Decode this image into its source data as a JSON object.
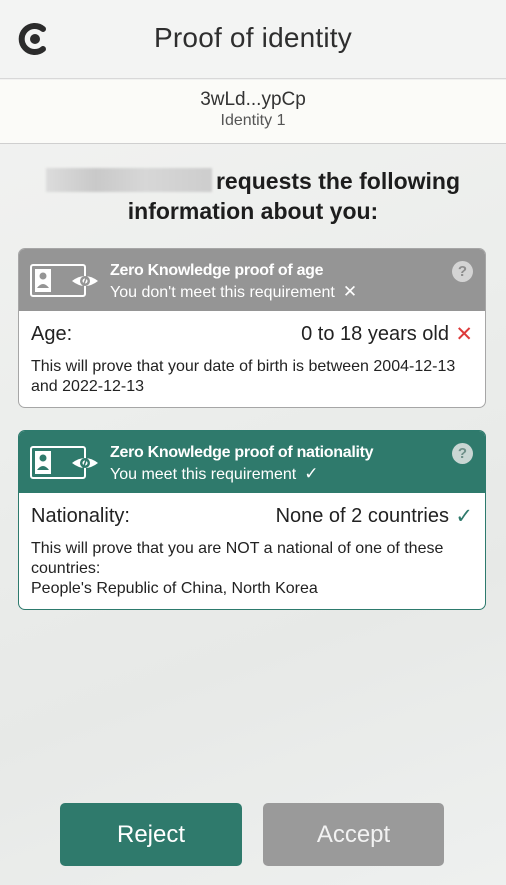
{
  "header": {
    "title": "Proof of identity",
    "logo_icon": "app-logo-icon"
  },
  "identity": {
    "address": "3wLd...ypCp",
    "name": "Identity 1"
  },
  "request": {
    "line1_suffix": "requests the following",
    "line2": "information about you:"
  },
  "cards": [
    {
      "title": "Zero Knowledge proof of age",
      "status": "You don't meet this requirement",
      "status_mark": "✕",
      "help": "?",
      "label": "Age:",
      "value": "0 to 18 years old",
      "value_mark": "✕",
      "description": "This will prove that your date of birth is between 2004-12-13 and 2022-12-13",
      "color": "#959595"
    },
    {
      "title": "Zero Knowledge proof of nationality",
      "status": "You meet this requirement",
      "status_mark": "✓",
      "help": "?",
      "label": "Nationality:",
      "value": "None of 2 countries",
      "value_mark": "✓",
      "description": "This will prove that you are NOT a national of one of these countries:",
      "countries": "People's Republic of China, North Korea",
      "color": "#2f7a6c"
    }
  ],
  "buttons": {
    "reject": "Reject",
    "accept": "Accept"
  },
  "colors": {
    "accent": "#2f7a6c",
    "disabled": "#9a9a9a",
    "error": "#dd3b3b"
  }
}
